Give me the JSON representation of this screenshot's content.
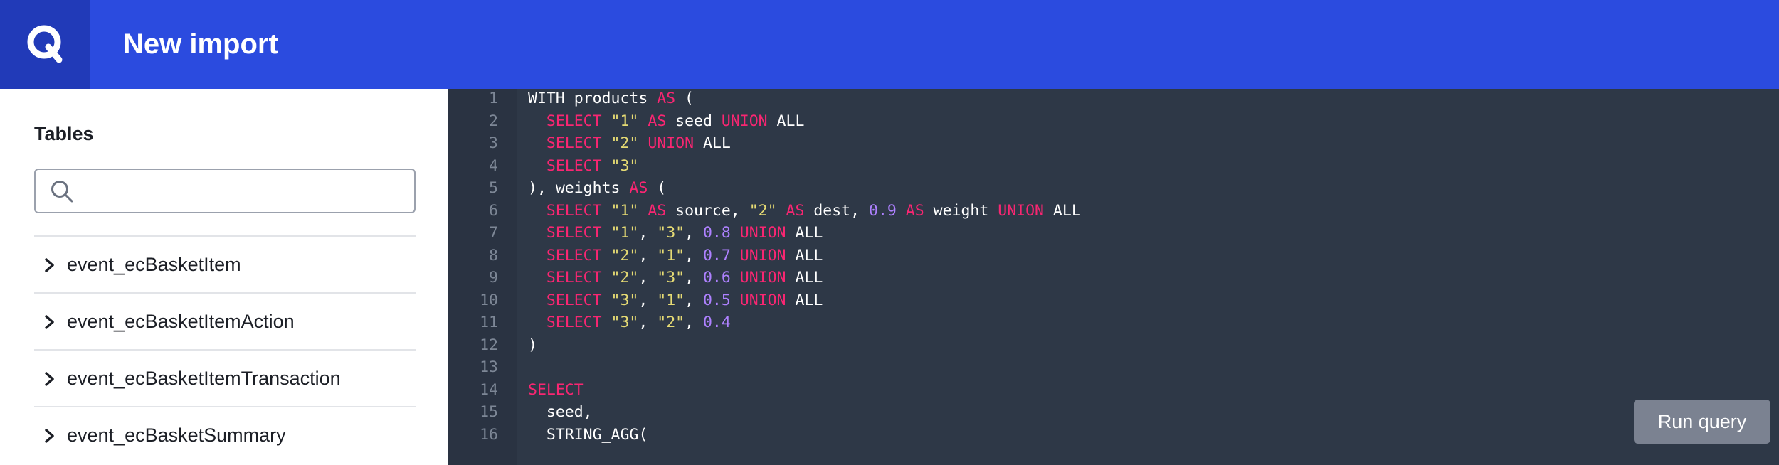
{
  "header": {
    "title": "New import",
    "logo_letter": "Q"
  },
  "sidebar": {
    "title": "Tables",
    "search": {
      "value": "",
      "placeholder": ""
    },
    "tables": [
      {
        "label": "event_ecBasketItem"
      },
      {
        "label": "event_ecBasketItemAction"
      },
      {
        "label": "event_ecBasketItemTransaction"
      },
      {
        "label": "event_ecBasketSummary"
      }
    ]
  },
  "editor": {
    "lines": [
      {
        "n": "1",
        "tokens": [
          [
            "p",
            "WITH products "
          ],
          [
            "k",
            "AS"
          ],
          [
            "p",
            " ("
          ]
        ]
      },
      {
        "n": "2",
        "tokens": [
          [
            "p",
            "  "
          ],
          [
            "k",
            "SELECT"
          ],
          [
            "p",
            " "
          ],
          [
            "s",
            "\"1\""
          ],
          [
            "p",
            " "
          ],
          [
            "k",
            "AS"
          ],
          [
            "p",
            " seed "
          ],
          [
            "k",
            "UNION"
          ],
          [
            "p",
            " ALL"
          ]
        ]
      },
      {
        "n": "3",
        "tokens": [
          [
            "p",
            "  "
          ],
          [
            "k",
            "SELECT"
          ],
          [
            "p",
            " "
          ],
          [
            "s",
            "\"2\""
          ],
          [
            "p",
            " "
          ],
          [
            "k",
            "UNION"
          ],
          [
            "p",
            " ALL"
          ]
        ]
      },
      {
        "n": "4",
        "tokens": [
          [
            "p",
            "  "
          ],
          [
            "k",
            "SELECT"
          ],
          [
            "p",
            " "
          ],
          [
            "s",
            "\"3\""
          ]
        ]
      },
      {
        "n": "5",
        "tokens": [
          [
            "p",
            "), weights "
          ],
          [
            "k",
            "AS"
          ],
          [
            "p",
            " ("
          ]
        ]
      },
      {
        "n": "6",
        "tokens": [
          [
            "p",
            "  "
          ],
          [
            "k",
            "SELECT"
          ],
          [
            "p",
            " "
          ],
          [
            "s",
            "\"1\""
          ],
          [
            "p",
            " "
          ],
          [
            "k",
            "AS"
          ],
          [
            "p",
            " source, "
          ],
          [
            "s",
            "\"2\""
          ],
          [
            "p",
            " "
          ],
          [
            "k",
            "AS"
          ],
          [
            "p",
            " dest, "
          ],
          [
            "n",
            "0.9"
          ],
          [
            "p",
            " "
          ],
          [
            "k",
            "AS"
          ],
          [
            "p",
            " weight "
          ],
          [
            "k",
            "UNION"
          ],
          [
            "p",
            " ALL"
          ]
        ]
      },
      {
        "n": "7",
        "tokens": [
          [
            "p",
            "  "
          ],
          [
            "k",
            "SELECT"
          ],
          [
            "p",
            " "
          ],
          [
            "s",
            "\"1\""
          ],
          [
            "p",
            ", "
          ],
          [
            "s",
            "\"3\""
          ],
          [
            "p",
            ", "
          ],
          [
            "n",
            "0.8"
          ],
          [
            "p",
            " "
          ],
          [
            "k",
            "UNION"
          ],
          [
            "p",
            " ALL"
          ]
        ]
      },
      {
        "n": "8",
        "tokens": [
          [
            "p",
            "  "
          ],
          [
            "k",
            "SELECT"
          ],
          [
            "p",
            " "
          ],
          [
            "s",
            "\"2\""
          ],
          [
            "p",
            ", "
          ],
          [
            "s",
            "\"1\""
          ],
          [
            "p",
            ", "
          ],
          [
            "n",
            "0.7"
          ],
          [
            "p",
            " "
          ],
          [
            "k",
            "UNION"
          ],
          [
            "p",
            " ALL"
          ]
        ]
      },
      {
        "n": "9",
        "tokens": [
          [
            "p",
            "  "
          ],
          [
            "k",
            "SELECT"
          ],
          [
            "p",
            " "
          ],
          [
            "s",
            "\"2\""
          ],
          [
            "p",
            ", "
          ],
          [
            "s",
            "\"3\""
          ],
          [
            "p",
            ", "
          ],
          [
            "n",
            "0.6"
          ],
          [
            "p",
            " "
          ],
          [
            "k",
            "UNION"
          ],
          [
            "p",
            " ALL"
          ]
        ]
      },
      {
        "n": "10",
        "tokens": [
          [
            "p",
            "  "
          ],
          [
            "k",
            "SELECT"
          ],
          [
            "p",
            " "
          ],
          [
            "s",
            "\"3\""
          ],
          [
            "p",
            ", "
          ],
          [
            "s",
            "\"1\""
          ],
          [
            "p",
            ", "
          ],
          [
            "n",
            "0.5"
          ],
          [
            "p",
            " "
          ],
          [
            "k",
            "UNION"
          ],
          [
            "p",
            " ALL"
          ]
        ]
      },
      {
        "n": "11",
        "tokens": [
          [
            "p",
            "  "
          ],
          [
            "k",
            "SELECT"
          ],
          [
            "p",
            " "
          ],
          [
            "s",
            "\"3\""
          ],
          [
            "p",
            ", "
          ],
          [
            "s",
            "\"2\""
          ],
          [
            "p",
            ", "
          ],
          [
            "n",
            "0.4"
          ]
        ]
      },
      {
        "n": "12",
        "tokens": [
          [
            "p",
            ")"
          ]
        ]
      },
      {
        "n": "13",
        "tokens": []
      },
      {
        "n": "14",
        "tokens": [
          [
            "k",
            "SELECT"
          ]
        ]
      },
      {
        "n": "15",
        "tokens": [
          [
            "p",
            "  seed,"
          ]
        ]
      },
      {
        "n": "16",
        "tokens": [
          [
            "p",
            "  STRING_AGG("
          ]
        ]
      }
    ]
  },
  "run_button": {
    "label": "Run query"
  },
  "colors": {
    "header": "#2b4bdf",
    "logo_bg": "#213ab8",
    "editor_bg": "#2e3847",
    "keyword": "#f92672",
    "string": "#e6db74",
    "number": "#ae81ff",
    "button": "#7b8291"
  },
  "icons": {
    "logo": "q-logo-icon",
    "search": "search-icon",
    "expand": "chevron-right-icon"
  }
}
